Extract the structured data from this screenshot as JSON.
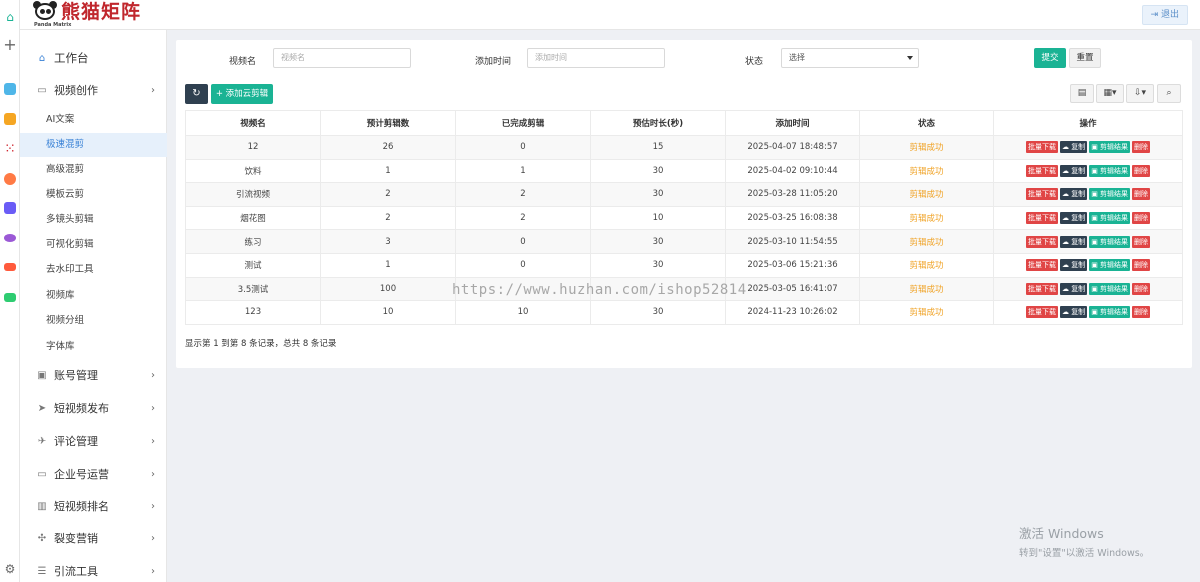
{
  "header": {
    "brand": "熊猫矩阵",
    "brand_sub": "Panda Matrix",
    "logout_label": "退出"
  },
  "rail": {
    "icons": [
      "home-icon",
      "plus-icon",
      "app-icon-1",
      "star-app-icon",
      "dots-app-icon",
      "ai-app-icon",
      "ai-badge-icon",
      "bot-app-icon",
      "game-app-icon",
      "mail-app-icon",
      "settings-icon"
    ]
  },
  "sidebar": {
    "home": "工作台",
    "video_creation": "视频创作",
    "sub_items": [
      "AI文案",
      "极速混剪",
      "高级混剪",
      "模板云剪",
      "多镜头剪辑",
      "可视化剪辑",
      "去水印工具",
      "视频库",
      "视频分组",
      "字体库"
    ],
    "active_sub": "极速混剪",
    "groups": [
      "账号管理",
      "短视频发布",
      "评论管理",
      "企业号运营",
      "短视频排名",
      "裂变营销",
      "引流工具"
    ]
  },
  "filters": {
    "video_name_label": "视频名",
    "video_name_placeholder": "视频名",
    "add_time_label": "添加时间",
    "add_time_placeholder": "添加时间",
    "status_label": "状态",
    "status_selected": "选择",
    "submit_label": "提交",
    "reset_label": "重置"
  },
  "toolbar": {
    "refresh_icon": "refresh-icon",
    "add_label": "添加云剪辑"
  },
  "table": {
    "columns": [
      "视频名",
      "预计剪辑数",
      "已完成剪辑",
      "预估时长(秒)",
      "添加时间",
      "状态",
      "操作"
    ],
    "rows": [
      {
        "name": "12",
        "planned": "26",
        "done": "0",
        "duration": "15",
        "added": "2025-04-07 18:48:57",
        "status": "剪辑成功"
      },
      {
        "name": "饮料",
        "planned": "1",
        "done": "1",
        "duration": "30",
        "added": "2025-04-02 09:10:44",
        "status": "剪辑成功"
      },
      {
        "name": "引流视频",
        "planned": "2",
        "done": "2",
        "duration": "30",
        "added": "2025-03-28 11:05:20",
        "status": "剪辑成功"
      },
      {
        "name": "烟花图",
        "planned": "2",
        "done": "2",
        "duration": "10",
        "added": "2025-03-25 16:08:38",
        "status": "剪辑成功"
      },
      {
        "name": "练习",
        "planned": "3",
        "done": "0",
        "duration": "30",
        "added": "2025-03-10 11:54:55",
        "status": "剪辑成功"
      },
      {
        "name": "测试",
        "planned": "1",
        "done": "0",
        "duration": "30",
        "added": "2025-03-06 15:21:36",
        "status": "剪辑成功"
      },
      {
        "name": "3.5测试",
        "planned": "100",
        "done": "",
        "duration": "",
        "added": "2025-03-05 16:41:07",
        "status": "剪辑成功"
      },
      {
        "name": "123",
        "planned": "10",
        "done": "10",
        "duration": "30",
        "added": "2024-11-23 10:26:02",
        "status": "剪辑成功"
      }
    ],
    "ops": {
      "batch_download": "批量下载",
      "copy": "复制",
      "results": "剪辑结果",
      "delete": "删除"
    }
  },
  "footer": {
    "summary": "显示第 1 到第 8 条记录，总共 8 条记录"
  },
  "watermark": "https://www.huzhan.com/ishop52814",
  "windows": {
    "line1": "激活 Windows",
    "line2": "转到\"设置\"以激活 Windows。"
  },
  "colors": {
    "accent": "#1ab394",
    "dark": "#2f4050",
    "danger": "#e04545",
    "status": "#f0a327",
    "link": "#3a82d6"
  }
}
